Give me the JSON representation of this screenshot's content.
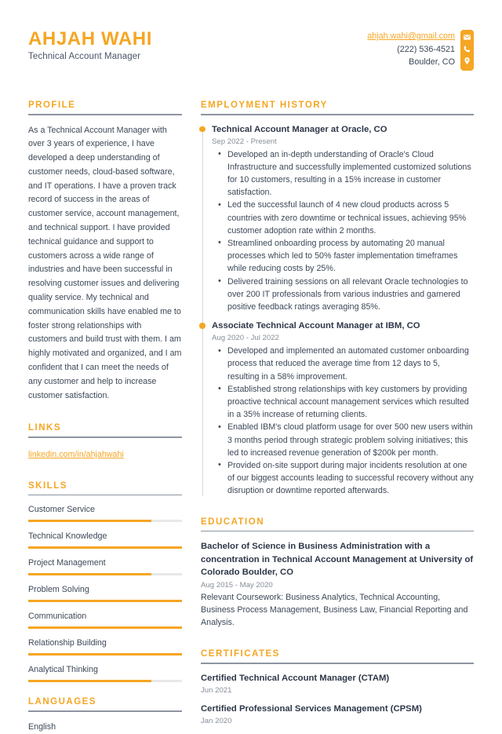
{
  "theme": {
    "accent": "#f5a623",
    "text": "#3c4858",
    "muted": "#868e99",
    "rule": "#8d95a0",
    "track": "#e8e8e8"
  },
  "header": {
    "full_name": "AHJAH WAHI",
    "job_title": "Technical Account Manager",
    "contact": {
      "email": "ahjah.wahi@gmail.com",
      "phone": "(222) 536-4521",
      "location": "Boulder, CO",
      "icons": [
        "envelope-icon",
        "phone-icon",
        "location-pin-icon"
      ]
    }
  },
  "sections": {
    "profile": {
      "title": "PROFILE",
      "text": "As a Technical Account Manager with over 3 years of experience, I have developed a deep understanding of customer needs, cloud-based software, and IT operations. I have a proven track record of success in the areas of customer service, account management, and technical support. I have provided technical guidance and support to customers across a wide range of industries and have been successful in resolving customer issues and delivering quality service. My technical and communication skills have enabled me to foster strong relationships with customers and build trust with them. I am highly motivated and organized, and I am confident that I can meet the needs of any customer and help to increase customer satisfaction."
    },
    "links": {
      "title": "LINKS",
      "items": [
        {
          "label": "linkedin.com/in/ahjahwahi"
        }
      ]
    },
    "skills": {
      "title": "SKILLS",
      "items": [
        {
          "name": "Customer Service",
          "level": 80
        },
        {
          "name": "Technical Knowledge",
          "level": 100
        },
        {
          "name": "Project Management",
          "level": 80
        },
        {
          "name": "Problem Solving",
          "level": 100
        },
        {
          "name": "Communication",
          "level": 100
        },
        {
          "name": "Relationship Building",
          "level": 100
        },
        {
          "name": "Analytical Thinking",
          "level": 80
        }
      ]
    },
    "languages": {
      "title": "LANGUAGES",
      "items": [
        {
          "name": "English"
        }
      ]
    },
    "employment": {
      "title": "EMPLOYMENT HISTORY",
      "jobs": [
        {
          "role": "Technical Account Manager at Oracle, CO",
          "date": "Sep 2022 - Present",
          "bullets": [
            "Developed an in-depth understanding of Oracle's Cloud Infrastructure and successfully implemented customized solutions for 10 customers, resulting in a 15% increase in customer satisfaction.",
            "Led the successful launch of 4 new cloud products across 5 countries with zero downtime or technical issues, achieving 95% customer adoption rate within 2 months.",
            "Streamlined onboarding process by automating 20 manual processes which led to 50% faster implementation timeframes while reducing costs by 25%.",
            "Delivered training sessions on all relevant Oracle technologies to over 200 IT professionals from various industries and garnered positive feedback ratings averaging 85%."
          ]
        },
        {
          "role": "Associate Technical Account Manager at IBM, CO",
          "date": "Aug 2020 - Jul 2022",
          "bullets": [
            "Developed and implemented an automated customer onboarding process that reduced the average time from 12 days to 5, resulting in a 58% improvement.",
            "Established strong relationships with key customers by providing proactive technical account management services which resulted in a 35% increase of returning clients.",
            "Enabled IBM's cloud platform usage for over 500 new users within 3 months period through strategic problem solving initiatives; this led to increased revenue generation of $200k per month.",
            "Provided on-site support during major incidents resolution at one of our biggest accounts leading to successful recovery without any disruption or downtime reported afterwards."
          ]
        }
      ]
    },
    "education": {
      "title": "EDUCATION",
      "entries": [
        {
          "degree": "Bachelor of Science in Business Administration with a concentration in Technical Account Management at University of Colorado Boulder, CO",
          "date": "Aug 2015 - May 2020",
          "description": "Relevant Coursework: Business Analytics, Technical Accounting, Business Process Management, Business Law, Financial Reporting and Analysis."
        }
      ]
    },
    "certificates": {
      "title": "CERTIFICATES",
      "entries": [
        {
          "name": "Certified Technical Account Manager (CTAM)",
          "date": "Jun 2021"
        },
        {
          "name": "Certified Professional Services Management (CPSM)",
          "date": "Jan 2020"
        }
      ]
    }
  }
}
